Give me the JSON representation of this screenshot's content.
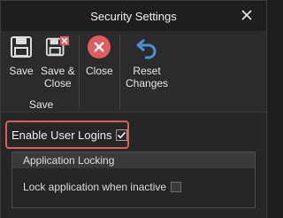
{
  "window": {
    "title": "Security Settings",
    "close_icon": "close-icon"
  },
  "ribbon": {
    "save": {
      "label": "Save",
      "icon": "save-icon"
    },
    "save_close": {
      "label": "Save &\nClose",
      "icon": "save-close-icon"
    },
    "group_save_label": "Save",
    "close": {
      "label": "Close",
      "icon": "close-circle-icon",
      "color": "#e15b5f"
    },
    "reset": {
      "label": "Reset\nChanges",
      "icon": "undo-icon",
      "color": "#4a90d9"
    }
  },
  "settings": {
    "enable_user_logins": {
      "label": "Enable User Logins",
      "checked": true
    },
    "application_locking": {
      "header": "Application Locking",
      "lock_when_inactive": {
        "label": "Lock application when inactive",
        "checked": false
      }
    }
  },
  "colors": {
    "highlight": "#e15b5f",
    "accent_blue": "#4a90d9"
  }
}
